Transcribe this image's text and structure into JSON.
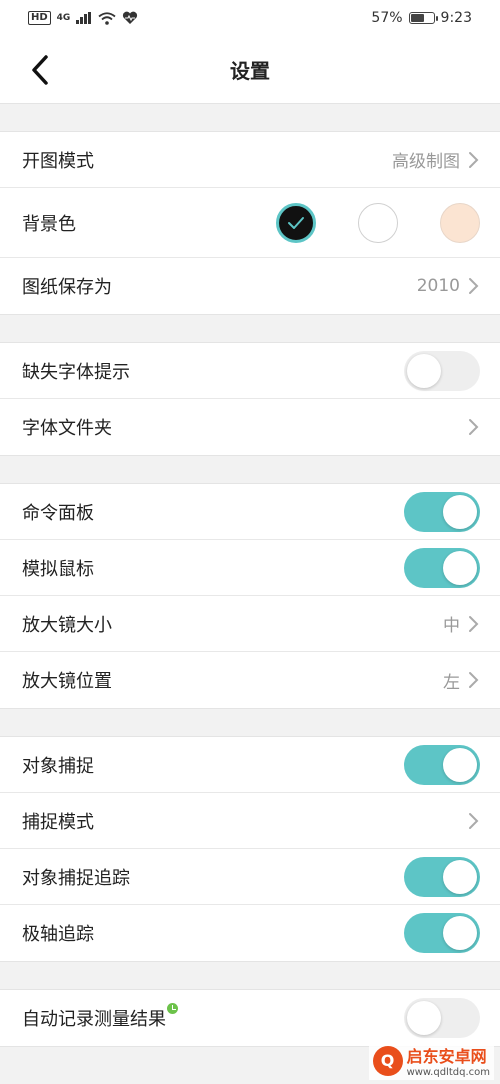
{
  "status_bar": {
    "network_hd": "HD",
    "network_4g": "4G",
    "battery_percent": "57%",
    "battery_level": 0.57,
    "time": "9:23"
  },
  "header": {
    "title": "设置"
  },
  "groups": [
    {
      "rows": [
        {
          "label": "开图模式",
          "value": "高级制图",
          "type": "nav"
        },
        {
          "label": "背景色",
          "type": "swatches",
          "options": [
            "#111111",
            "#ffffff",
            "#fbe4d2"
          ],
          "selected": 0
        },
        {
          "label": "图纸保存为",
          "value": "2010",
          "type": "nav"
        }
      ]
    },
    {
      "rows": [
        {
          "label": "缺失字体提示",
          "type": "toggle",
          "on": false
        },
        {
          "label": "字体文件夹",
          "type": "nav"
        }
      ]
    },
    {
      "rows": [
        {
          "label": "命令面板",
          "type": "toggle",
          "on": true
        },
        {
          "label": "模拟鼠标",
          "type": "toggle",
          "on": true
        },
        {
          "label": "放大镜大小",
          "value": "中",
          "type": "nav"
        },
        {
          "label": "放大镜位置",
          "value": "左",
          "type": "nav"
        }
      ]
    },
    {
      "rows": [
        {
          "label": "对象捕捉",
          "type": "toggle",
          "on": true
        },
        {
          "label": "捕捉模式",
          "type": "nav"
        },
        {
          "label": "对象捕捉追踪",
          "type": "toggle",
          "on": true
        },
        {
          "label": "极轴追踪",
          "type": "toggle",
          "on": true
        }
      ]
    },
    {
      "rows": [
        {
          "label": "自动记录测量结果",
          "type": "toggle",
          "on": false
        }
      ]
    }
  ],
  "colors": {
    "accent": "#5dc5c6",
    "toggle_off": "#eeeeee",
    "value_text": "#999999"
  },
  "watermark": {
    "name": "启东安卓网",
    "url": "www.qdltdq.com"
  }
}
